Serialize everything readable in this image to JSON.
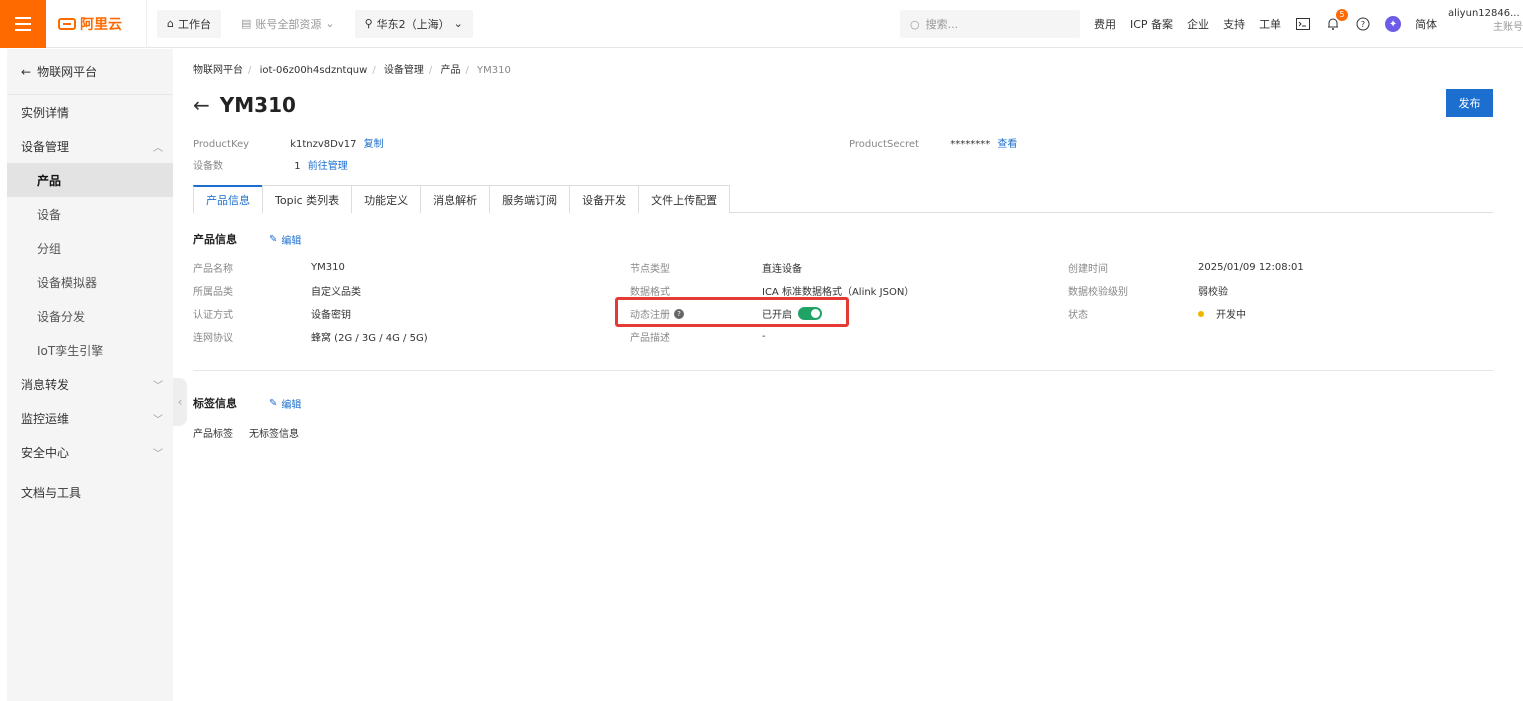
{
  "topbar": {
    "brand": "阿里云",
    "workbench": "工作台",
    "account_resources": "账号全部资源",
    "region": "华东2（上海）",
    "search_placeholder": "搜索...",
    "links": [
      "费用",
      "ICP 备案",
      "企业",
      "支持",
      "工单"
    ],
    "notification_count": "5",
    "language": "简体",
    "username": "aliyun12846...",
    "account_type": "主账号"
  },
  "sidebar": {
    "back_label": "物联网平台",
    "items": [
      {
        "label": "实例详情"
      },
      {
        "label": "设备管理"
      },
      {
        "label": "产品"
      },
      {
        "label": "设备"
      },
      {
        "label": "分组"
      },
      {
        "label": "设备模拟器"
      },
      {
        "label": "设备分发"
      },
      {
        "label": "IoT孪生引擎"
      },
      {
        "label": "消息转发"
      },
      {
        "label": "监控运维"
      },
      {
        "label": "安全中心"
      },
      {
        "label": "文档与工具"
      }
    ]
  },
  "breadcrumb": [
    "物联网平台",
    "iot-06z00h4sdzntquw",
    "设备管理",
    "产品",
    "YM310"
  ],
  "page": {
    "title": "YM310",
    "publish_label": "发布"
  },
  "meta": {
    "product_key_label": "ProductKey",
    "product_key": "k1tnzv8Dv17",
    "copy_label": "复制",
    "device_count_label": "设备数",
    "device_count": "1",
    "manage_label": "前往管理",
    "product_secret_label": "ProductSecret",
    "product_secret": "********",
    "view_label": "查看"
  },
  "tabs": [
    "产品信息",
    "Topic 类列表",
    "功能定义",
    "消息解析",
    "服务端订阅",
    "设备开发",
    "文件上传配置"
  ],
  "product_info": {
    "section_title": "产品信息",
    "edit_label": "编辑",
    "fields": {
      "name_label": "产品名称",
      "name": "YM310",
      "category_label": "所属品类",
      "category": "自定义品类",
      "auth_label": "认证方式",
      "auth": "设备密钥",
      "network_label": "连网协议",
      "network": "蜂窝 (2G / 3G / 4G / 5G)",
      "node_type_label": "节点类型",
      "node_type": "直连设备",
      "data_format_label": "数据格式",
      "data_format": "ICA 标准数据格式（Alink JSON）",
      "dynamic_reg_label": "动态注册",
      "dynamic_reg": "已开启",
      "desc_label": "产品描述",
      "desc": "-",
      "created_label": "创建时间",
      "created": "2025/01/09 12:08:01",
      "verify_label": "数据校验级别",
      "verify": "弱校验",
      "status_label": "状态",
      "status": "开发中"
    }
  },
  "tag_info": {
    "section_title": "标签信息",
    "edit_label": "编辑",
    "tag_label": "产品标签",
    "tag_value": "无标签信息"
  },
  "colors": {
    "brand": "#ff6a00",
    "primary": "#1c6fcf",
    "toggle_on": "#21a366",
    "status_dev": "#f0b400",
    "highlight": "#e53935"
  }
}
